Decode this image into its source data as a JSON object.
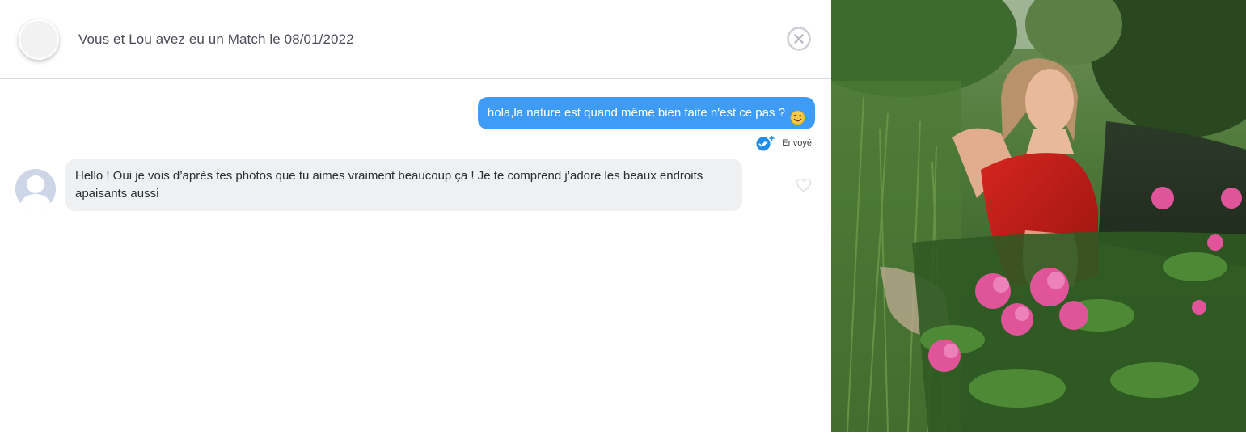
{
  "header": {
    "title": "Vous et Lou avez eu un Match le 08/01/2022"
  },
  "messages": {
    "outgoing": {
      "text": "hola,la nature est quand même bien faite n'est ce pas ?",
      "emoji": "winking-face",
      "status": "Envoyé"
    },
    "incoming": {
      "text": "Hello ! Oui je vois d’après tes photos que tu aimes vraiment beaucoup ça ! Je te comprend j’adore les beaux endroits apaisants aussi"
    }
  },
  "icons": {
    "close": "close-circle-icon",
    "sent_status": "double-check-icon",
    "like": "heart-outline-icon"
  },
  "colors": {
    "outgoing_bubble": "#3f9cf6",
    "incoming_bubble": "#eff0f2",
    "status_check": "#1f8ce6"
  }
}
